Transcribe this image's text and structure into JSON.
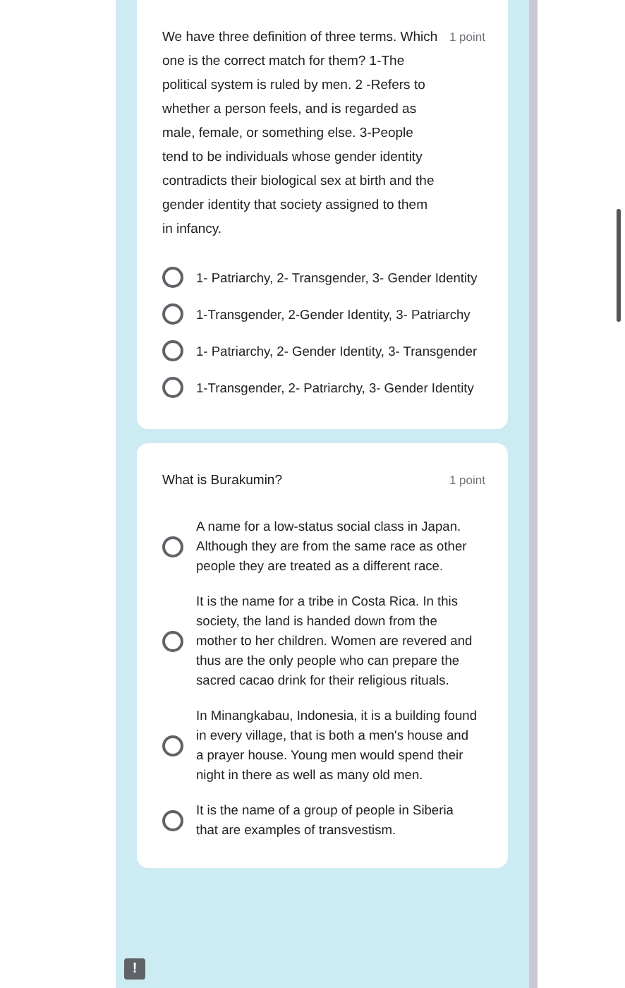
{
  "questions": [
    {
      "text": "We have three definition of three terms. Which one is the correct match for them? 1-The political system is ruled by men. 2 -Refers to whether a person feels, and is regarded as male, female, or something else. 3-People tend to be individuals whose gender identity contradicts their biological sex at birth and the gender identity that society assigned to them in infancy.",
      "points": "1 point",
      "options": [
        {
          "label": "1- Patriarchy, 2- Transgender, 3- Gender Identity",
          "selected": false
        },
        {
          "label": "1-Transgender, 2-Gender Identity, 3- Patriarchy",
          "selected": false
        },
        {
          "label": "1- Patriarchy, 2- Gender Identity, 3- Transgender",
          "selected": false
        },
        {
          "label": "1-Transgender, 2- Patriarchy, 3- Gender Identity",
          "selected": false
        }
      ]
    },
    {
      "text": "What is Burakumin?",
      "points": "1 point",
      "options": [
        {
          "label": "A name for a low-status social class in Japan. Although they are from the same race as other people they are treated as a different race.",
          "selected": false
        },
        {
          "label": "It is the name for a tribe in Costa Rica. In this society, the land is handed down from the mother to her children. Women are revered and thus are the only people who can prepare the sacred cacao drink for their religious rituals.",
          "selected": false
        },
        {
          "label": "In Minangkabau, Indonesia, it is a building found in every village, that is both a men's house and a prayer house. Young men would spend their night in there as well as many old men.",
          "selected": false
        },
        {
          "label": "It is the name of a group of people in Siberia that are examples of transvestism.",
          "selected": false
        }
      ]
    }
  ],
  "feedback_button": {
    "text": "!"
  }
}
